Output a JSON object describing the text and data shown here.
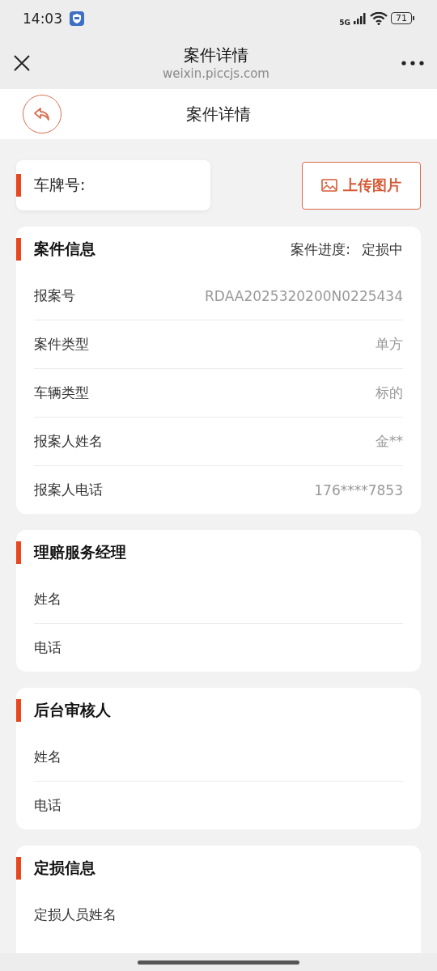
{
  "status_bar": {
    "time": "14:03",
    "network": "5G",
    "battery": "71"
  },
  "browser_bar": {
    "title": "案件详情",
    "url": "weixin.piccjs.com"
  },
  "page_header": {
    "title": "案件详情"
  },
  "plate": {
    "label": "车牌号:"
  },
  "upload_button": {
    "label": "上传图片"
  },
  "sections": [
    {
      "title": "案件信息",
      "progress_label": "案件进度:",
      "progress_value": "定损中",
      "rows": [
        {
          "label": "报案号",
          "value": "RDAA2025320200N0225434"
        },
        {
          "label": "案件类型",
          "value": "单方"
        },
        {
          "label": "车辆类型",
          "value": "标的"
        },
        {
          "label": "报案人姓名",
          "value": "金**"
        },
        {
          "label": "报案人电话",
          "value": "176****7853"
        }
      ]
    },
    {
      "title": "理赔服务经理",
      "rows": [
        {
          "label": "姓名"
        },
        {
          "label": "电话"
        }
      ]
    },
    {
      "title": "后台审核人",
      "rows": [
        {
          "label": "姓名"
        },
        {
          "label": "电话"
        }
      ]
    },
    {
      "title": "定损信息",
      "rows": [
        {
          "label": "定损人员姓名"
        }
      ]
    }
  ]
}
